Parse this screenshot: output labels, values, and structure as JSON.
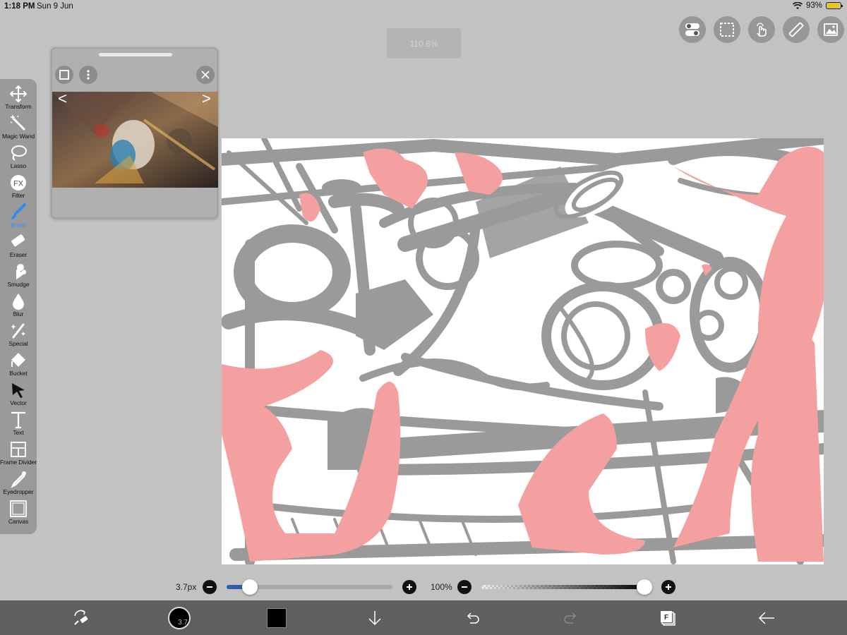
{
  "status_bar": {
    "time": "1:18 PM",
    "date": "Sun 9 Jun",
    "battery": "93%",
    "battery_level": 0.93,
    "wifi_icon": "wifi-icon"
  },
  "zoom_label": "110.8%",
  "top_tools": [
    {
      "name": "toggle-settings-icon"
    },
    {
      "name": "selection-icon"
    },
    {
      "name": "hand-gesture-icon"
    },
    {
      "name": "ruler-icon"
    },
    {
      "name": "gallery-icon"
    }
  ],
  "toolbar": {
    "items": [
      {
        "label": "Transform",
        "icon": "transform-icon"
      },
      {
        "label": "Magic Wand",
        "icon": "magic-wand-icon"
      },
      {
        "label": "Lasso",
        "icon": "lasso-icon"
      },
      {
        "label": "Filter",
        "icon": "filter-icon"
      },
      {
        "label": "Brush",
        "icon": "brush-icon",
        "active": true
      },
      {
        "label": "Eraser",
        "icon": "eraser-icon"
      },
      {
        "label": "Smudge",
        "icon": "smudge-icon"
      },
      {
        "label": "Blur",
        "icon": "blur-icon"
      },
      {
        "label": "Special",
        "icon": "special-icon"
      },
      {
        "label": "Bucket",
        "icon": "bucket-icon"
      },
      {
        "label": "Vector",
        "icon": "vector-icon"
      },
      {
        "label": "Text",
        "icon": "text-icon"
      },
      {
        "label": "Frame Divider",
        "icon": "frame-divider-icon"
      },
      {
        "label": "Eyedropper",
        "icon": "eyedropper-icon"
      },
      {
        "label": "Canvas",
        "icon": "canvas-icon"
      }
    ],
    "active_color": "#2d8df0"
  },
  "reference": {
    "prev": "<",
    "next": ">",
    "filter_icon_text": "FX"
  },
  "brush_size": {
    "label": "3.7px",
    "level": 0.06
  },
  "opacity": {
    "label": "100%",
    "level": 1.0
  },
  "bottom_bar": {
    "brush_size_badge": "3.7",
    "current_color": "#000000",
    "layers_badge": "F"
  },
  "colors": {
    "sketch_pink": "#f5a0a0",
    "sketch_gray": "#9a9a9a",
    "app_bg": "#c2c2c2",
    "toolbar_bg": "#9a9a9a",
    "bottom_bg": "#5f5f5f"
  }
}
